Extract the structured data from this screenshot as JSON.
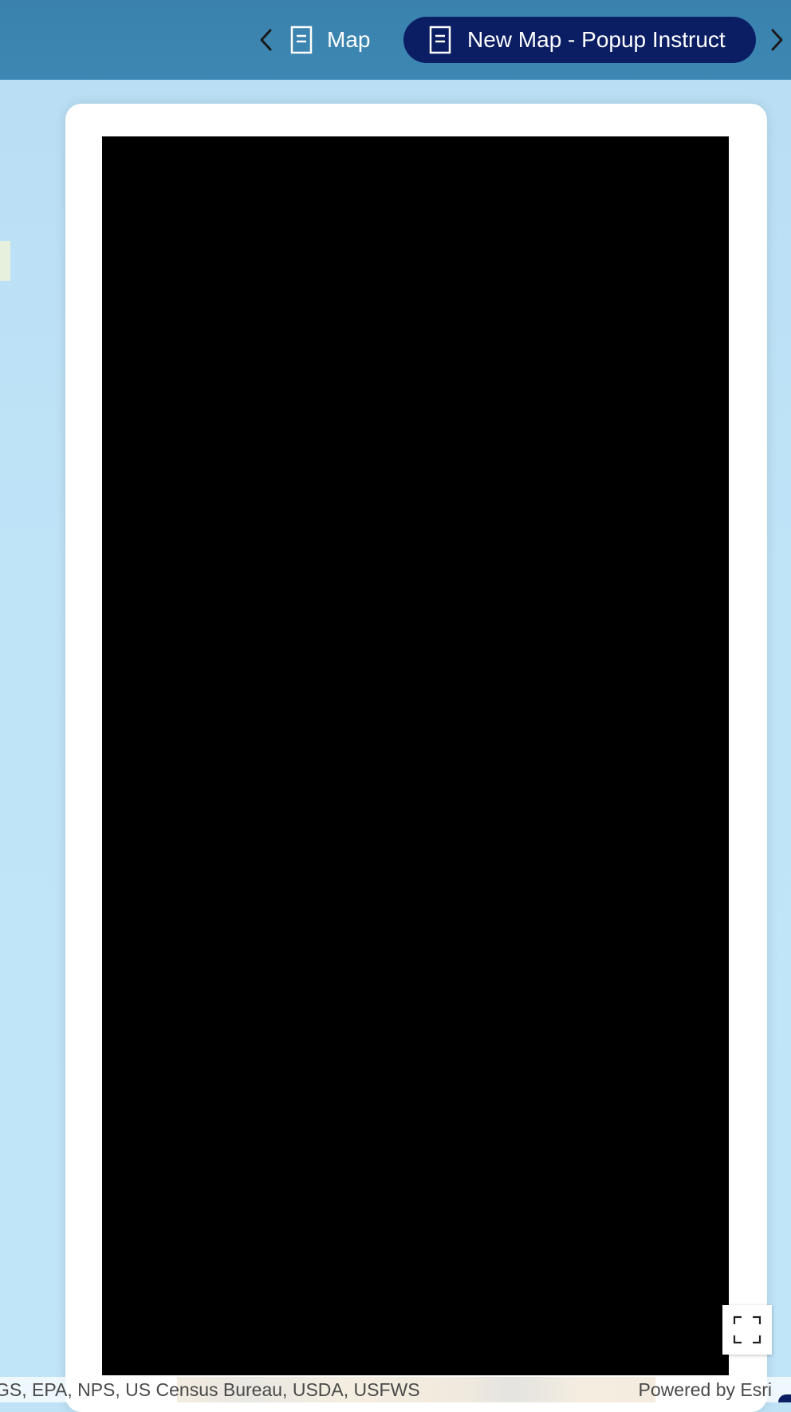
{
  "header": {
    "tabs": [
      {
        "label": "Map",
        "icon": "document-icon",
        "active": false
      },
      {
        "label": "New Map - Popup Instruct",
        "icon": "document-icon",
        "active": true
      }
    ],
    "prev_icon": "chevron-left-icon",
    "next_icon": "chevron-right-icon"
  },
  "card": {
    "media_background": "#000000",
    "fullscreen_icon": "fullscreen-icon"
  },
  "attribution": {
    "sources": "GS, EPA, NPS, US Census Bureau, USDA, USFWS",
    "powered_by": "Powered by Esri"
  },
  "colors": {
    "header": "#3c87b3",
    "active_tab": "#0b1e63",
    "map_water": "#bfe3f7"
  }
}
